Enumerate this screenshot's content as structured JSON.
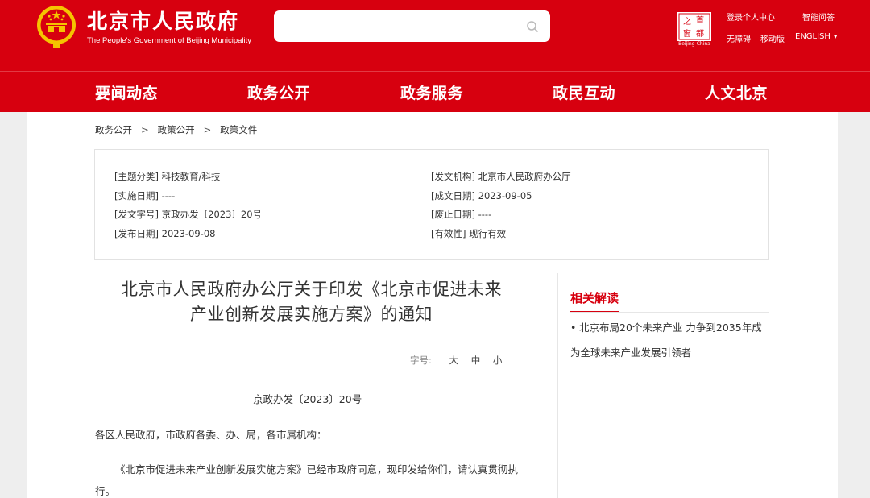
{
  "header": {
    "site_name_cn": "北京市人民政府",
    "site_name_en": "The People's Government of Beijing Municipality",
    "search": {
      "placeholder": ""
    },
    "capital_logo_text": "Beijing-China",
    "links": {
      "login": "登录个人中心",
      "qa": "智能问答",
      "accessible": "无障碍",
      "mobile": "移动版",
      "english": "ENGLISH",
      "english_arrow": "▾"
    }
  },
  "nav": {
    "items": [
      "要闻动态",
      "政务公开",
      "政务服务",
      "政民互动",
      "人文北京"
    ]
  },
  "breadcrumb": {
    "items": [
      "政务公开",
      "政策公开",
      "政策文件"
    ],
    "separator": ">"
  },
  "meta": {
    "topic": "[主题分类] 科技教育/科技",
    "effective_date": "[实施日期] ----",
    "doc_no": "[发文字号] 京政办发〔2023〕20号",
    "publish_date": "[发布日期] 2023-09-08",
    "issuer": "[发文机构] 北京市人民政府办公厅",
    "written_date": "[成文日期] 2023-09-05",
    "abolish_date": "[废止日期] ----",
    "validity": "[有效性] 现行有效"
  },
  "article": {
    "title_line1": "北京市人民政府办公厅关于印发《北京市促进未来",
    "title_line2": "产业创新发展实施方案》的通知",
    "font_size_label": "字号:",
    "font_large": "大",
    "font_medium": "中",
    "font_small": "小",
    "doc_number": "京政办发〔2023〕20号",
    "addressee": "各区人民政府，市政府各委、办、局，各市属机构：",
    "body": "《北京市促进未来产业创新发展实施方案》已经市政府同意，现印发给你们，请认真贯彻执行。"
  },
  "related": {
    "title": "相关解读",
    "items": [
      {
        "bullet": "•",
        "text": "北京布局20个未来产业 力争到2035年成为全球未来产业发展引领者"
      }
    ]
  },
  "colors": {
    "brand_red": "#d7000f",
    "gold": "#f5c400"
  }
}
